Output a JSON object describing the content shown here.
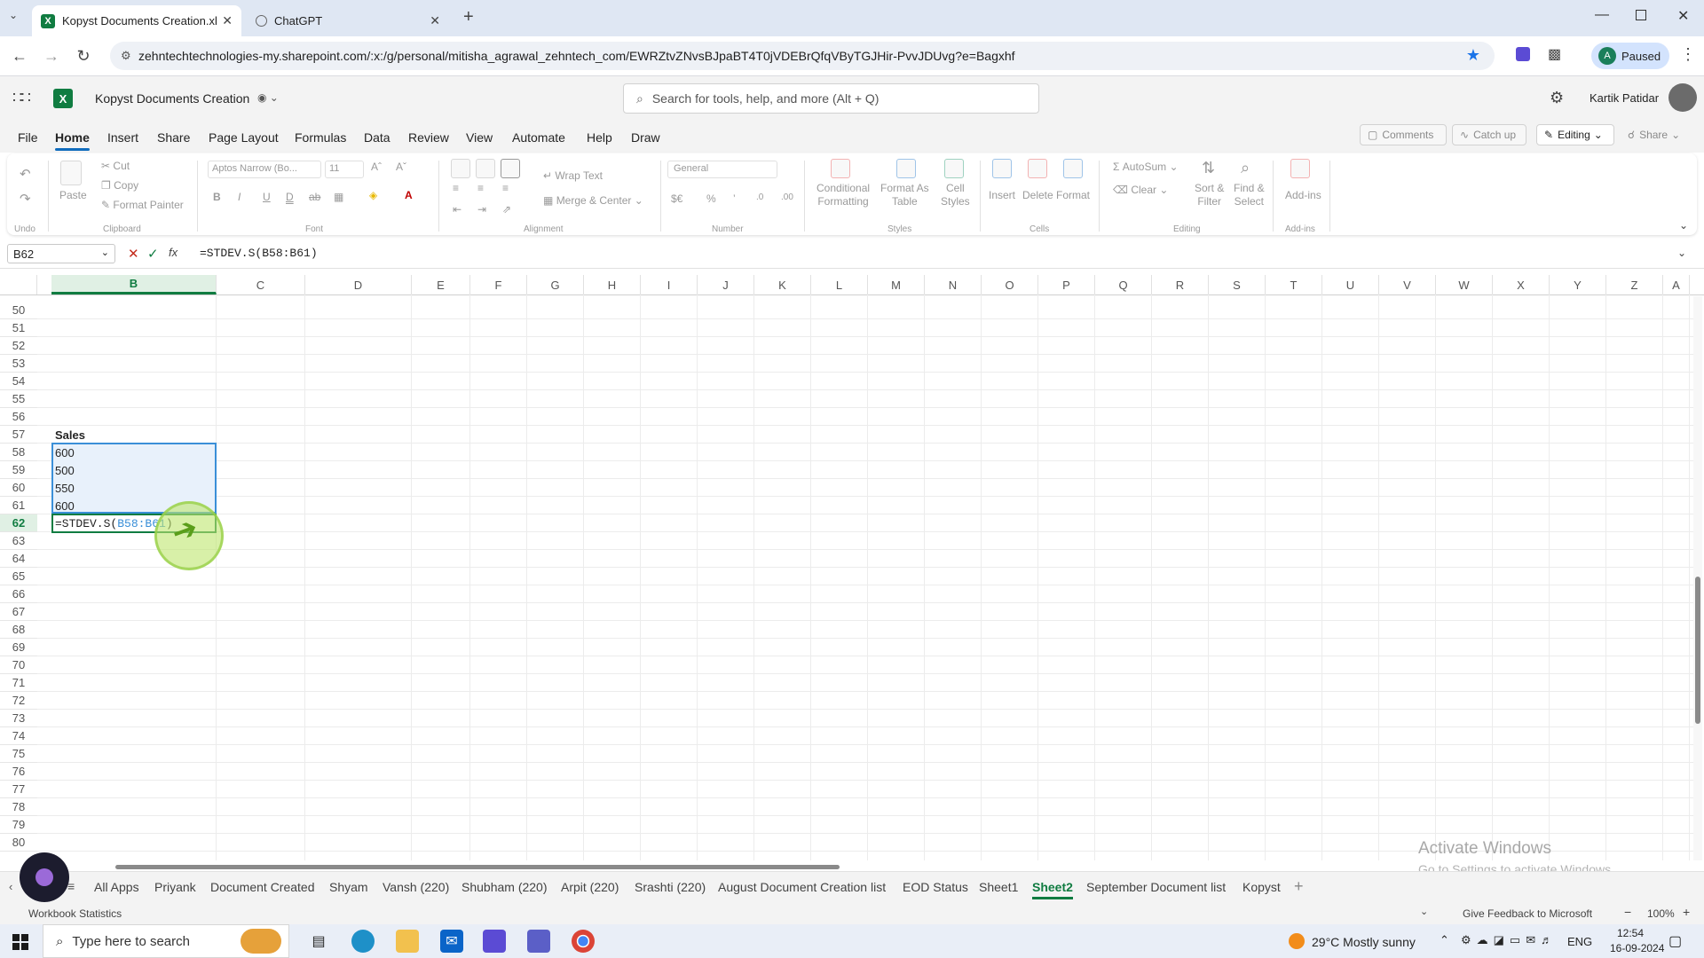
{
  "browser": {
    "tabs": [
      {
        "label": "Kopyst Documents Creation.xls",
        "active": true
      },
      {
        "label": "ChatGPT",
        "active": false
      }
    ],
    "url": "zehntechtechnologies-my.sharepoint.com/:x:/g/personal/mitisha_agrawal_zehntech_com/EWRZtvZNvsBJpaBT4T0jVDEBrQfqVByTGJHir-PvvJDUvg?e=Bagxhf",
    "profile": {
      "initial": "A",
      "status": "Paused"
    }
  },
  "app": {
    "title": "Kopyst Documents Creation",
    "search_placeholder": "Search for tools, help, and more (Alt + Q)",
    "user_name": "Kartik Patidar"
  },
  "menu": {
    "tabs": [
      "File",
      "Home",
      "Insert",
      "Share",
      "Page Layout",
      "Formulas",
      "Data",
      "Review",
      "View",
      "Automate",
      "Help",
      "Draw"
    ],
    "active": "Home",
    "comments": "Comments",
    "catchup": "Catch up",
    "editing": "Editing",
    "share": "Share"
  },
  "ribbon": {
    "undo": "Undo",
    "paste": "Paste",
    "cut": "Cut",
    "copy": "Copy",
    "format_painter": "Format Painter",
    "clipboard": "Clipboard",
    "font_name": "Aptos Narrow (Bo...",
    "font_size": "11",
    "font": "Font",
    "wrap_text": "Wrap Text",
    "merge_center": "Merge & Center",
    "alignment": "Alignment",
    "number_format": "General",
    "number": "Number",
    "conditional_formatting_1": "Conditional",
    "conditional_formatting_2": "Formatting",
    "format_as_table_1": "Format As",
    "format_as_table_2": "Table",
    "cell_styles_1": "Cell",
    "cell_styles_2": "Styles",
    "styles": "Styles",
    "insert": "Insert",
    "delete": "Delete",
    "format": "Format",
    "cells": "Cells",
    "autosum": "AutoSum",
    "clear": "Clear",
    "sort_filter_1": "Sort &",
    "sort_filter_2": "Filter",
    "find_select_1": "Find &",
    "find_select_2": "Select",
    "editing": "Editing",
    "addins": "Add-ins",
    "addins_group": "Add-ins"
  },
  "formula_bar": {
    "name_box": "B62",
    "formula": "=STDEV.S(B58:B61)"
  },
  "grid": {
    "columns": [
      "B",
      "C",
      "D",
      "E",
      "F",
      "G",
      "H",
      "I",
      "J",
      "K",
      "L",
      "M",
      "N",
      "O",
      "P",
      "Q",
      "R",
      "S",
      "T",
      "U",
      "V",
      "W",
      "X",
      "Y",
      "Z",
      "A"
    ],
    "rows": [
      "50",
      "51",
      "52",
      "53",
      "54",
      "55",
      "56",
      "57",
      "58",
      "59",
      "60",
      "61",
      "62",
      "63",
      "64",
      "65",
      "66",
      "67",
      "68",
      "69",
      "70",
      "71",
      "72",
      "73",
      "74",
      "75",
      "76",
      "77",
      "78",
      "79",
      "80"
    ],
    "cells": {
      "B57": "Sales",
      "B58": "600",
      "B59": "500",
      "B60": "550",
      "B61": "600",
      "B62_prefix": "=STDEV.S(",
      "B62_ref": "B58:B61",
      "B62_suffix": ")"
    },
    "watermark_title": "Activate Windows",
    "watermark_sub": "Go to Settings to activate Windows."
  },
  "sheets": {
    "tabs": [
      "All Apps",
      "Priyank",
      "Document Created",
      "Shyam",
      "Vansh (220)",
      "Shubham (220)",
      "Arpit (220)",
      "Srashti (220)",
      "August Document Creation list",
      "EOD Status",
      "Sheet1",
      "Sheet2",
      "September Document list",
      "Kopyst"
    ],
    "active": "Sheet2"
  },
  "status": {
    "left": "Workbook Statistics",
    "feedback": "Give Feedback to Microsoft",
    "zoom": "100%"
  },
  "taskbar": {
    "search_placeholder": "Type here to search",
    "weather": "29°C  Mostly sunny",
    "language": "ENG",
    "time": "12:54",
    "date": "16-09-2024"
  },
  "colors": {
    "excel_green": "#107c41",
    "selection_blue": "#e8f1fb",
    "accent_blue": "#0f6cbd"
  }
}
